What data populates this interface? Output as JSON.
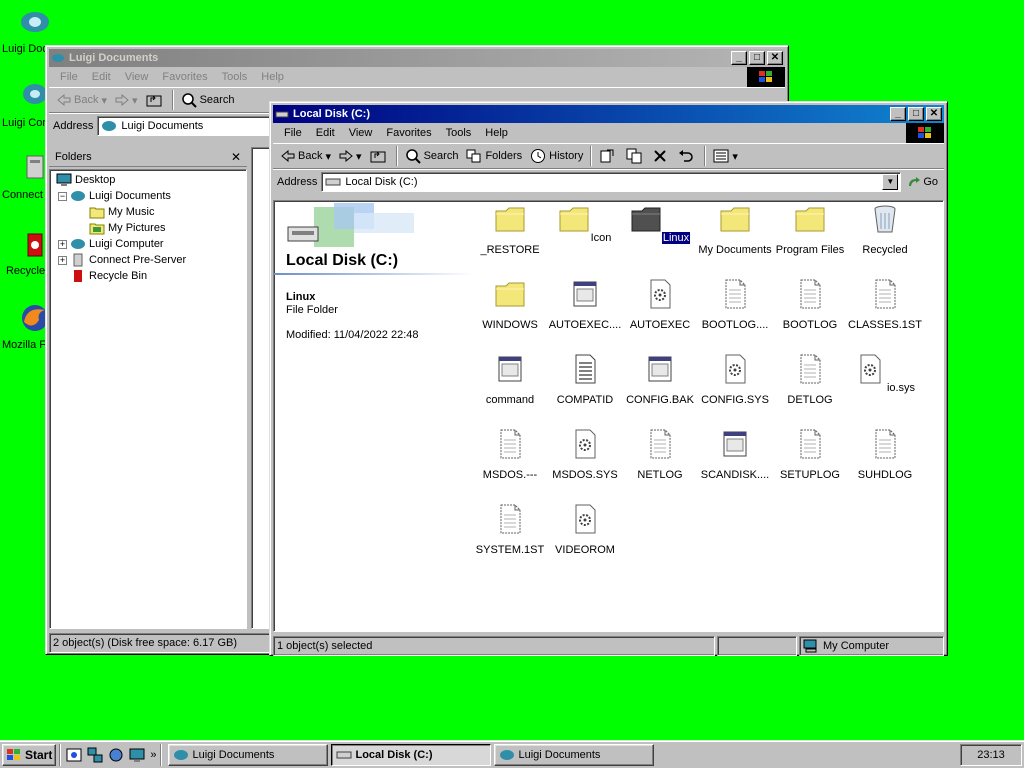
{
  "desktop": {
    "icons": [
      {
        "label": "Luigi Documents",
        "icon": "luigi-documents-icon"
      },
      {
        "label": "Luigi Computer",
        "icon": "luigi-computer-icon"
      },
      {
        "label": "Connect Pre-Server",
        "icon": "connect-icon"
      },
      {
        "label": "Recycle Bin",
        "icon": "recycle-bin-icon"
      },
      {
        "label": "Mozilla Firefox",
        "icon": "firefox-icon"
      }
    ]
  },
  "win_back": {
    "title": "Luigi Documents",
    "menu": [
      "File",
      "Edit",
      "View",
      "Favorites",
      "Tools",
      "Help"
    ],
    "toolbar": {
      "back": "Back",
      "search": "Search"
    },
    "address_label": "Address",
    "address_value": "Luigi Documents",
    "folders_title": "Folders",
    "tree": [
      {
        "label": "Desktop",
        "level": 0,
        "pm": "",
        "icon": "desktop-icon"
      },
      {
        "label": "Luigi Documents",
        "level": 1,
        "pm": "−",
        "icon": "luigi-documents-icon"
      },
      {
        "label": "My Music",
        "level": 2,
        "pm": "",
        "icon": "folder-icon"
      },
      {
        "label": "My Pictures",
        "level": 2,
        "pm": "",
        "icon": "pictures-folder-icon"
      },
      {
        "label": "Luigi Computer",
        "level": 1,
        "pm": "+",
        "icon": "computer-icon"
      },
      {
        "label": "Connect Pre-Server",
        "level": 1,
        "pm": "+",
        "icon": "server-icon"
      },
      {
        "label": "Recycle Bin",
        "level": 1,
        "pm": "",
        "icon": "recycle-bin-icon"
      }
    ],
    "status": "2 object(s) (Disk free space: 6.17 GB)"
  },
  "win_front": {
    "title": "Local Disk (C:)",
    "menu": [
      "File",
      "Edit",
      "View",
      "Favorites",
      "Tools",
      "Help"
    ],
    "toolbar": {
      "back": "Back",
      "search": "Search",
      "folders": "Folders",
      "history": "History"
    },
    "address_label": "Address",
    "address_value": "Local Disk (C:)",
    "go_label": "Go",
    "side": {
      "heading": "Local Disk (C:)",
      "sel_name": "Linux",
      "sel_type": "File Folder",
      "sel_modified": "Modified: 11/04/2022 22:48"
    },
    "files": [
      {
        "label": "_RESTORE",
        "icon": "folder"
      },
      {
        "label": "Icon",
        "icon": "folder"
      },
      {
        "label": "Linux",
        "icon": "folder",
        "selected": true
      },
      {
        "label": "My Documents",
        "icon": "folder"
      },
      {
        "label": "Program Files",
        "icon": "folder"
      },
      {
        "label": "Recycled",
        "icon": "recycle"
      },
      {
        "label": "WINDOWS",
        "icon": "folder"
      },
      {
        "label": "AUTOEXEC....",
        "icon": "window"
      },
      {
        "label": "AUTOEXEC",
        "icon": "gear"
      },
      {
        "label": "BOOTLOG....",
        "icon": "doc"
      },
      {
        "label": "BOOTLOG",
        "icon": "doc"
      },
      {
        "label": "CLASSES.1ST",
        "icon": "doc"
      },
      {
        "label": "command",
        "icon": "window"
      },
      {
        "label": "COMPATID",
        "icon": "text"
      },
      {
        "label": "CONFIG.BAK",
        "icon": "window"
      },
      {
        "label": "CONFIG.SYS",
        "icon": "gear"
      },
      {
        "label": "DETLOG",
        "icon": "doc"
      },
      {
        "label": "io.sys",
        "icon": "gear"
      },
      {
        "label": "MSDOS.---",
        "icon": "doc"
      },
      {
        "label": "MSDOS.SYS",
        "icon": "gear"
      },
      {
        "label": "NETLOG",
        "icon": "doc"
      },
      {
        "label": "SCANDISK....",
        "icon": "window"
      },
      {
        "label": "SETUPLOG",
        "icon": "doc"
      },
      {
        "label": "SUHDLOG",
        "icon": "doc"
      },
      {
        "label": "SYSTEM.1ST",
        "icon": "doc"
      },
      {
        "label": "VIDEOROM",
        "icon": "gear"
      }
    ],
    "status_left": "1 object(s) selected",
    "status_right": "My Computer"
  },
  "taskbar": {
    "start": "Start",
    "buttons": [
      {
        "label": "Luigi Documents",
        "pressed": false
      },
      {
        "label": "Local Disk (C:)",
        "pressed": true
      },
      {
        "label": "Luigi Documents",
        "pressed": false
      }
    ],
    "clock": "23:13"
  },
  "colors": {
    "desktop": "#00ff00",
    "title_active": "#000080",
    "folder": "#f4e77a",
    "selection": "#000080"
  }
}
